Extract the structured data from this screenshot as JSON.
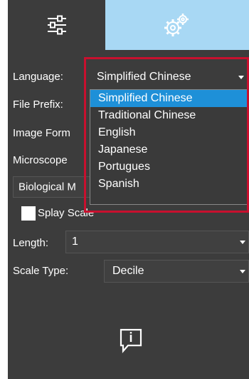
{
  "tabs": [
    {
      "icon": "sliders-icon"
    },
    {
      "icon": "settings-gear-icon"
    }
  ],
  "language": {
    "label": "Language:",
    "value": "Simplified Chinese"
  },
  "file_prefix": {
    "label": "File Prefix:"
  },
  "image_format": {
    "label": "Image Form"
  },
  "microscope": {
    "label": "Microscope",
    "value": "Biological M"
  },
  "language_options": [
    "Simplified Chinese",
    "Traditional Chinese",
    "English",
    "Japanese",
    "Portugues",
    "Spanish"
  ],
  "display_scale": {
    "label": "Splay Scale",
    "checked": true
  },
  "length": {
    "label": "Length:",
    "value": "1"
  },
  "scale_type": {
    "label": "Scale Type:",
    "value": "Decile"
  },
  "colors": {
    "accent": "#1e90d8",
    "tab_active": "#a8d8f4",
    "highlight_box": "#c8102e",
    "panel": "#3c3c3c"
  }
}
